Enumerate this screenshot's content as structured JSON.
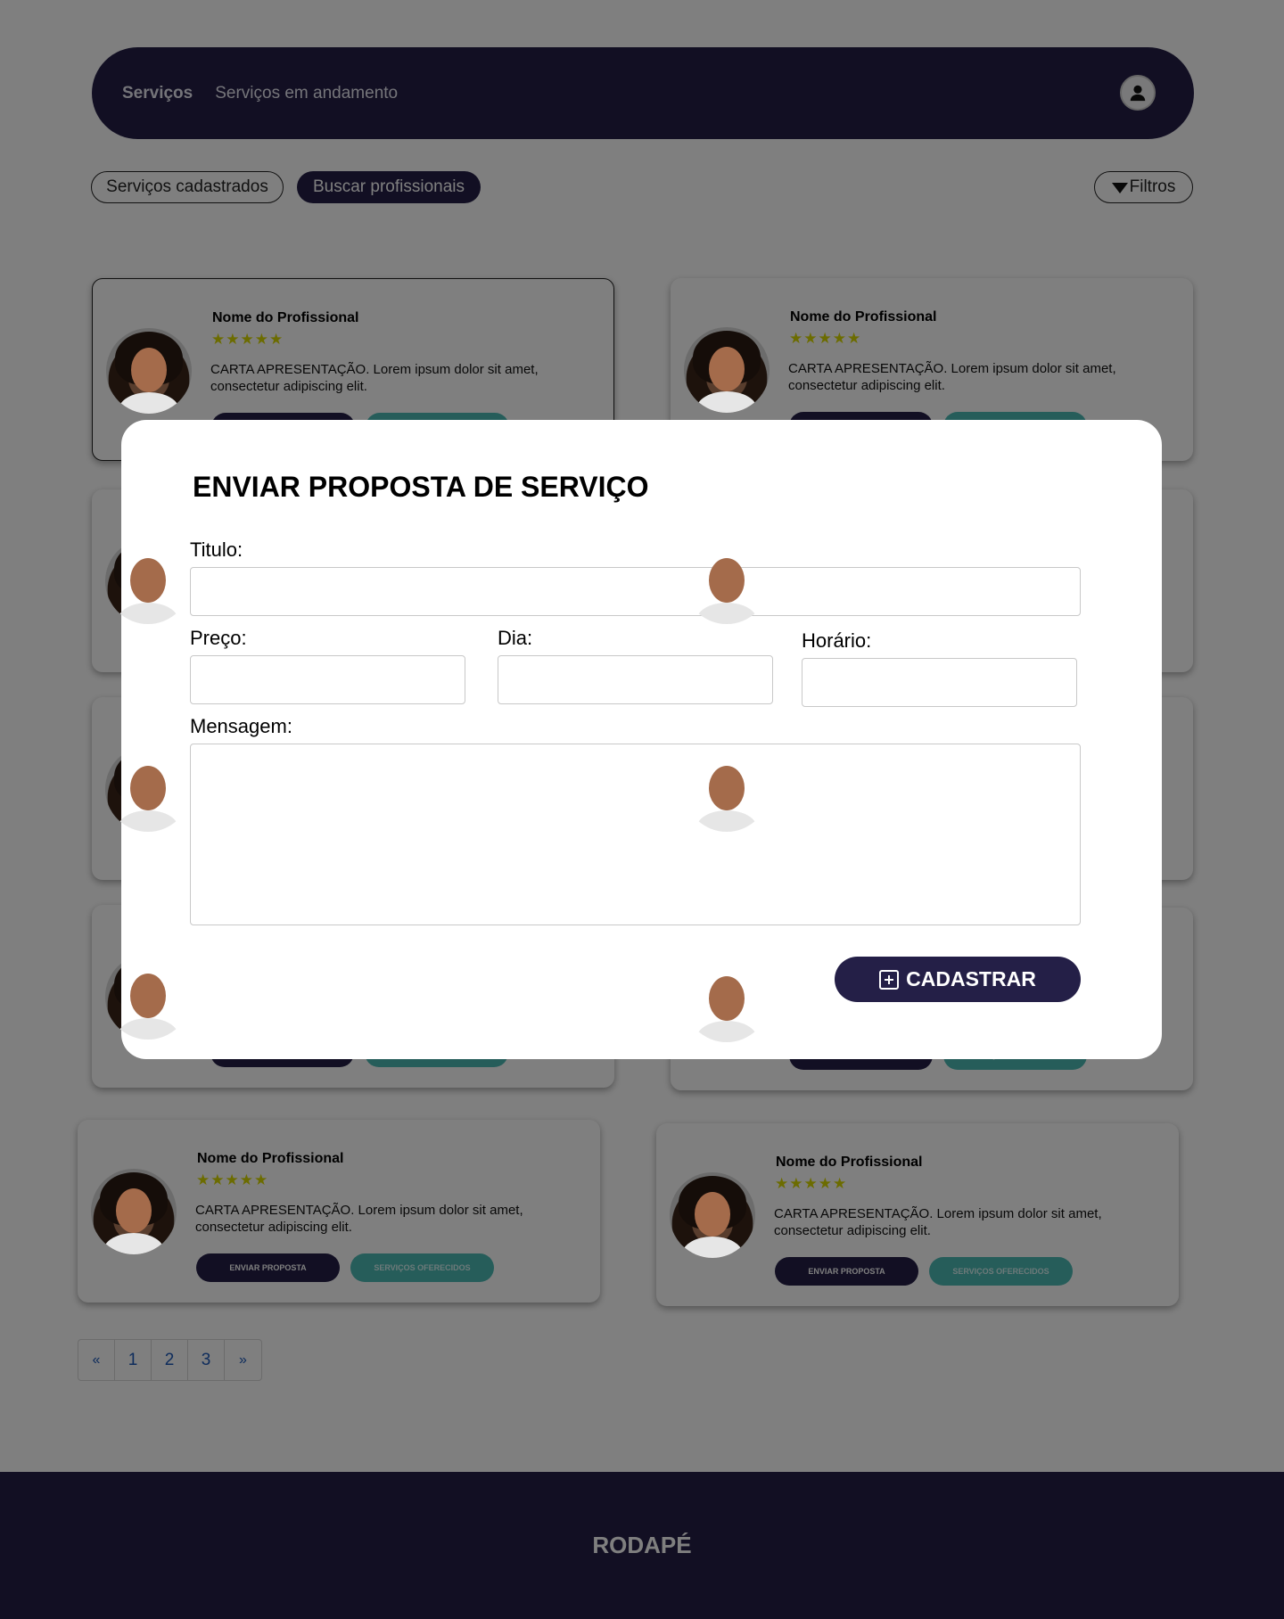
{
  "nav": {
    "links": [
      "Serviços",
      "Serviços em andamento"
    ]
  },
  "tabs": {
    "registered": "Serviços cadastrados",
    "search": "Buscar profissionais",
    "filters": "Filtros"
  },
  "card": {
    "name": "Nome do Profissional",
    "stars": "★★★★★",
    "rating": 5,
    "bio": "CARTA APRESENTAÇÃO. Lorem ipsum dolor sit amet, consectetur adipiscing elit.",
    "send_label": "ENVIAR PROPOSTA",
    "services_label": "SERVIÇOS OFERECIDOS"
  },
  "pagination": [
    "«",
    "1",
    "2",
    "3",
    "»"
  ],
  "footer": {
    "label": "RODAPÉ"
  },
  "modal": {
    "title": "ENVIAR PROPOSTA DE SERVIÇO",
    "title_label": "Titulo:",
    "price_label": "Preço:",
    "day_label": "Dia:",
    "time_label": "Horário:",
    "message_label": "Mensagem:",
    "submit_label": "CADASTRAR",
    "values": {
      "title": "",
      "price": "",
      "day": "",
      "time": "",
      "message": ""
    }
  },
  "colors": {
    "brand": "#241f47",
    "accent": "#4cbab5",
    "stars": "#d8d800"
  }
}
